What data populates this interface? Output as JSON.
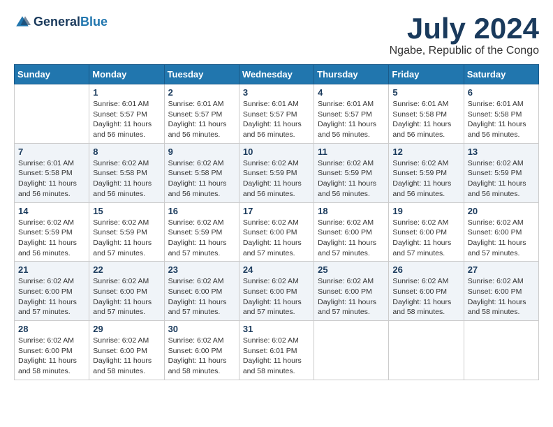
{
  "logo": {
    "line1": "General",
    "line2": "Blue"
  },
  "title": "July 2024",
  "location": "Ngabe, Republic of the Congo",
  "weekdays": [
    "Sunday",
    "Monday",
    "Tuesday",
    "Wednesday",
    "Thursday",
    "Friday",
    "Saturday"
  ],
  "weeks": [
    [
      {
        "day": "",
        "sunrise": "",
        "sunset": "",
        "daylight": ""
      },
      {
        "day": "1",
        "sunrise": "Sunrise: 6:01 AM",
        "sunset": "Sunset: 5:57 PM",
        "daylight": "Daylight: 11 hours and 56 minutes."
      },
      {
        "day": "2",
        "sunrise": "Sunrise: 6:01 AM",
        "sunset": "Sunset: 5:57 PM",
        "daylight": "Daylight: 11 hours and 56 minutes."
      },
      {
        "day": "3",
        "sunrise": "Sunrise: 6:01 AM",
        "sunset": "Sunset: 5:57 PM",
        "daylight": "Daylight: 11 hours and 56 minutes."
      },
      {
        "day": "4",
        "sunrise": "Sunrise: 6:01 AM",
        "sunset": "Sunset: 5:57 PM",
        "daylight": "Daylight: 11 hours and 56 minutes."
      },
      {
        "day": "5",
        "sunrise": "Sunrise: 6:01 AM",
        "sunset": "Sunset: 5:58 PM",
        "daylight": "Daylight: 11 hours and 56 minutes."
      },
      {
        "day": "6",
        "sunrise": "Sunrise: 6:01 AM",
        "sunset": "Sunset: 5:58 PM",
        "daylight": "Daylight: 11 hours and 56 minutes."
      }
    ],
    [
      {
        "day": "7",
        "sunrise": "Sunrise: 6:01 AM",
        "sunset": "Sunset: 5:58 PM",
        "daylight": "Daylight: 11 hours and 56 minutes."
      },
      {
        "day": "8",
        "sunrise": "Sunrise: 6:02 AM",
        "sunset": "Sunset: 5:58 PM",
        "daylight": "Daylight: 11 hours and 56 minutes."
      },
      {
        "day": "9",
        "sunrise": "Sunrise: 6:02 AM",
        "sunset": "Sunset: 5:58 PM",
        "daylight": "Daylight: 11 hours and 56 minutes."
      },
      {
        "day": "10",
        "sunrise": "Sunrise: 6:02 AM",
        "sunset": "Sunset: 5:59 PM",
        "daylight": "Daylight: 11 hours and 56 minutes."
      },
      {
        "day": "11",
        "sunrise": "Sunrise: 6:02 AM",
        "sunset": "Sunset: 5:59 PM",
        "daylight": "Daylight: 11 hours and 56 minutes."
      },
      {
        "day": "12",
        "sunrise": "Sunrise: 6:02 AM",
        "sunset": "Sunset: 5:59 PM",
        "daylight": "Daylight: 11 hours and 56 minutes."
      },
      {
        "day": "13",
        "sunrise": "Sunrise: 6:02 AM",
        "sunset": "Sunset: 5:59 PM",
        "daylight": "Daylight: 11 hours and 56 minutes."
      }
    ],
    [
      {
        "day": "14",
        "sunrise": "Sunrise: 6:02 AM",
        "sunset": "Sunset: 5:59 PM",
        "daylight": "Daylight: 11 hours and 56 minutes."
      },
      {
        "day": "15",
        "sunrise": "Sunrise: 6:02 AM",
        "sunset": "Sunset: 5:59 PM",
        "daylight": "Daylight: 11 hours and 57 minutes."
      },
      {
        "day": "16",
        "sunrise": "Sunrise: 6:02 AM",
        "sunset": "Sunset: 5:59 PM",
        "daylight": "Daylight: 11 hours and 57 minutes."
      },
      {
        "day": "17",
        "sunrise": "Sunrise: 6:02 AM",
        "sunset": "Sunset: 6:00 PM",
        "daylight": "Daylight: 11 hours and 57 minutes."
      },
      {
        "day": "18",
        "sunrise": "Sunrise: 6:02 AM",
        "sunset": "Sunset: 6:00 PM",
        "daylight": "Daylight: 11 hours and 57 minutes."
      },
      {
        "day": "19",
        "sunrise": "Sunrise: 6:02 AM",
        "sunset": "Sunset: 6:00 PM",
        "daylight": "Daylight: 11 hours and 57 minutes."
      },
      {
        "day": "20",
        "sunrise": "Sunrise: 6:02 AM",
        "sunset": "Sunset: 6:00 PM",
        "daylight": "Daylight: 11 hours and 57 minutes."
      }
    ],
    [
      {
        "day": "21",
        "sunrise": "Sunrise: 6:02 AM",
        "sunset": "Sunset: 6:00 PM",
        "daylight": "Daylight: 11 hours and 57 minutes."
      },
      {
        "day": "22",
        "sunrise": "Sunrise: 6:02 AM",
        "sunset": "Sunset: 6:00 PM",
        "daylight": "Daylight: 11 hours and 57 minutes."
      },
      {
        "day": "23",
        "sunrise": "Sunrise: 6:02 AM",
        "sunset": "Sunset: 6:00 PM",
        "daylight": "Daylight: 11 hours and 57 minutes."
      },
      {
        "day": "24",
        "sunrise": "Sunrise: 6:02 AM",
        "sunset": "Sunset: 6:00 PM",
        "daylight": "Daylight: 11 hours and 57 minutes."
      },
      {
        "day": "25",
        "sunrise": "Sunrise: 6:02 AM",
        "sunset": "Sunset: 6:00 PM",
        "daylight": "Daylight: 11 hours and 57 minutes."
      },
      {
        "day": "26",
        "sunrise": "Sunrise: 6:02 AM",
        "sunset": "Sunset: 6:00 PM",
        "daylight": "Daylight: 11 hours and 58 minutes."
      },
      {
        "day": "27",
        "sunrise": "Sunrise: 6:02 AM",
        "sunset": "Sunset: 6:00 PM",
        "daylight": "Daylight: 11 hours and 58 minutes."
      }
    ],
    [
      {
        "day": "28",
        "sunrise": "Sunrise: 6:02 AM",
        "sunset": "Sunset: 6:00 PM",
        "daylight": "Daylight: 11 hours and 58 minutes."
      },
      {
        "day": "29",
        "sunrise": "Sunrise: 6:02 AM",
        "sunset": "Sunset: 6:00 PM",
        "daylight": "Daylight: 11 hours and 58 minutes."
      },
      {
        "day": "30",
        "sunrise": "Sunrise: 6:02 AM",
        "sunset": "Sunset: 6:00 PM",
        "daylight": "Daylight: 11 hours and 58 minutes."
      },
      {
        "day": "31",
        "sunrise": "Sunrise: 6:02 AM",
        "sunset": "Sunset: 6:01 PM",
        "daylight": "Daylight: 11 hours and 58 minutes."
      },
      {
        "day": "",
        "sunrise": "",
        "sunset": "",
        "daylight": ""
      },
      {
        "day": "",
        "sunrise": "",
        "sunset": "",
        "daylight": ""
      },
      {
        "day": "",
        "sunrise": "",
        "sunset": "",
        "daylight": ""
      }
    ]
  ]
}
